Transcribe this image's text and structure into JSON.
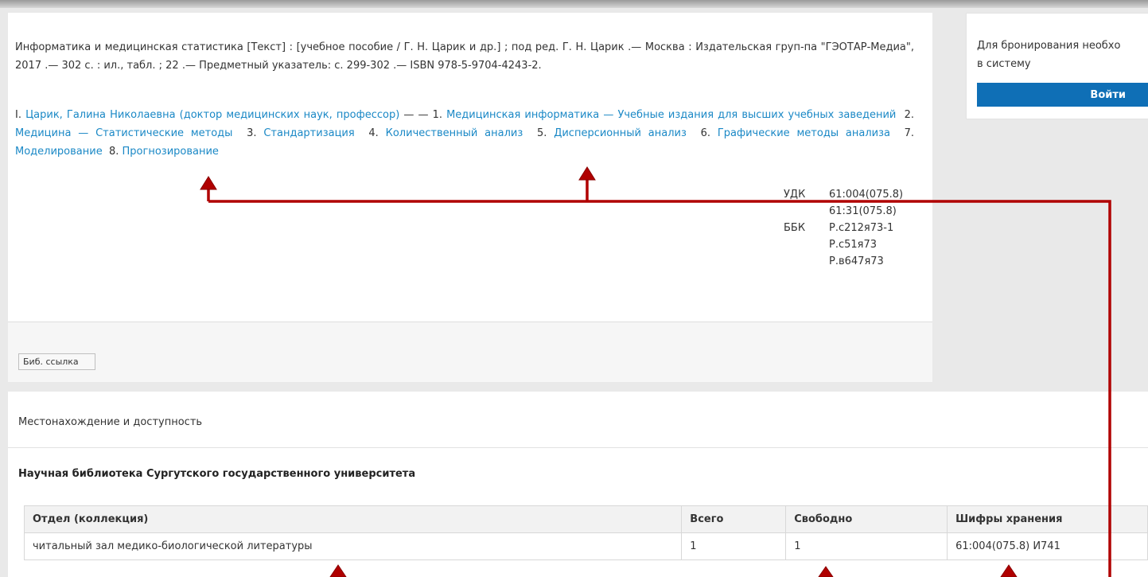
{
  "record": {
    "description": "Информатика и медицинская статистика [Текст] : [учебное пособие / Г. Н. Царик и др.] ; под ред. Г. Н. Царик .— Москва : Издательская груп-па \"ГЭОТАР-Медиа\", 2017 .— 302 с. : ил., табл. ; 22 .— Предметный указатель: с. 299-302 .— ISBN 978-5-9704-4243-2.",
    "author_prefix": "I. ",
    "author": "Царик, Галина Николаевна (доктор медицинских наук, профессор)",
    "author_sep": " — — ",
    "subjects": [
      {
        "num": "1. ",
        "label": "Медицинская информатика — Учебные издания для высших учебных заведений"
      },
      {
        "num": "2. ",
        "label": "Медицина — Статистические методы"
      },
      {
        "num": "3. ",
        "label": "Стандартизация"
      },
      {
        "num": "4. ",
        "label": "Количественный анализ"
      },
      {
        "num": "5. ",
        "label": "Дисперсионный анализ"
      },
      {
        "num": "6. ",
        "label": "Графические методы анализа"
      },
      {
        "num": "7. ",
        "label": "Моделирование"
      },
      {
        "num": "8. ",
        "label": "Прогнозирование"
      }
    ],
    "classification": [
      {
        "label": "УДК",
        "value": "61:004(075.8)"
      },
      {
        "label": "",
        "value": "61:31(075.8)"
      },
      {
        "label": "ББК",
        "value": "Р.с212я73-1"
      },
      {
        "label": "",
        "value": "Р.с51я73"
      },
      {
        "label": "",
        "value": "Р.в647я73"
      }
    ],
    "bib_link_button": "Биб. ссылка"
  },
  "login": {
    "message": "Для бронирования необхо в систему",
    "message_line1": "Для бронирования необхо",
    "message_line2": "в систему",
    "button": "Войти"
  },
  "location": {
    "title": "Местонахождение и доступность",
    "library": "Научная библиотека Сургутского государственного университета",
    "columns": [
      "Отдел (коллекция)",
      "Всего",
      "Свободно",
      "Шифры хранения"
    ],
    "rows": [
      [
        "читальный зал медико-биологической литературы",
        "1",
        "1",
        "61:004(075.8) И741"
      ]
    ]
  },
  "colors": {
    "link": "#1a88c6",
    "button": "#0f6fb6",
    "arrow": "#b00000"
  }
}
